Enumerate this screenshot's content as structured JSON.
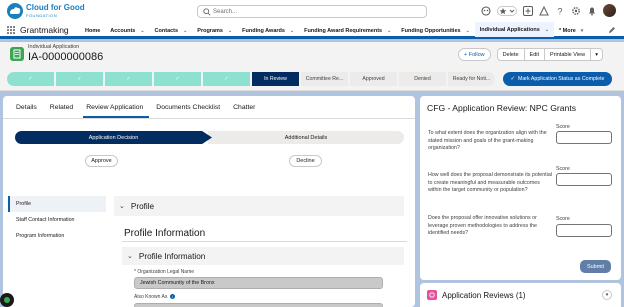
{
  "header": {
    "logo_text": "Cloud for Good",
    "logo_sub": "FOUNDATION",
    "search_placeholder": "Search..."
  },
  "nav": {
    "app_name": "Grantmaking",
    "items": [
      {
        "label": "Home",
        "chevron": ""
      },
      {
        "label": "Accounts",
        "chevron": "⌄"
      },
      {
        "label": "Contacts",
        "chevron": "⌄"
      },
      {
        "label": "Programs",
        "chevron": "⌄"
      },
      {
        "label": "Funding Awards",
        "chevron": "⌄"
      },
      {
        "label": "Funding Award Requirements",
        "chevron": "⌄"
      },
      {
        "label": "Funding Opportunities",
        "chevron": "⌄"
      },
      {
        "label": "Individual Applications",
        "chevron": "⌄"
      },
      {
        "label": "* More",
        "chevron": "▾"
      }
    ]
  },
  "record": {
    "type": "Individual Application",
    "name": "IA-0000000086",
    "buttons": {
      "follow": "+ Follow",
      "delete": "Delete",
      "edit": "Edit",
      "printable": "Printable View",
      "dropdown": "▾"
    }
  },
  "path": {
    "stages": [
      {
        "label": "✓",
        "state": "done"
      },
      {
        "label": "✓",
        "state": "done"
      },
      {
        "label": "✓",
        "state": "done"
      },
      {
        "label": "✓",
        "state": "done"
      },
      {
        "label": "✓",
        "state": "done"
      },
      {
        "label": "In Review",
        "state": "cur"
      },
      {
        "label": "Committee Re...",
        "state": "todo"
      },
      {
        "label": "Approved",
        "state": "todo"
      },
      {
        "label": "Denied",
        "state": "todo"
      },
      {
        "label": "Ready for Noti...",
        "state": "todo"
      }
    ],
    "mark_button": "Mark Application Status as Complete",
    "check": "✓"
  },
  "tabs": [
    "Details",
    "Related",
    "Review Application",
    "Documents Checklist",
    "Chatter"
  ],
  "review": {
    "sub_stages": [
      "Application Decision",
      "Additional Details"
    ],
    "approve": "Approve",
    "decline": "Decline",
    "side_nav": [
      "Profile",
      "Staff Contact Information",
      "Program Information"
    ],
    "section_profile": "Profile",
    "profile_title": "Profile Information",
    "subsection": "Profile Information",
    "chevron": "⌄",
    "field1_label": "* Organization Legal Name",
    "field1_value": "Jewish Community of the Bronx",
    "field2_label": "Also Known As",
    "info": "i"
  },
  "evaluation": {
    "title": "CFG - Application Review: NPC Grants",
    "score_label": "Score",
    "questions": [
      "To what extent does the organization align with the stated mission and goals of the grant-making organization?",
      "How well does the proposal demonstrate its potential to create meaningful and measurable outcomes within the target community or population?",
      "Does the proposal offer innovative solutions or leverage proven methodologies to address the identified needs?"
    ],
    "submit": "Submit"
  },
  "reviews": {
    "title": "Application Reviews (1)",
    "dropdown": "▾"
  },
  "colors": {
    "brand": "#0b5cab",
    "path_current": "#032d60",
    "path_done": "#8ee0d0",
    "record_icon": "#3ba755",
    "reviews_icon": "#e3549b"
  }
}
